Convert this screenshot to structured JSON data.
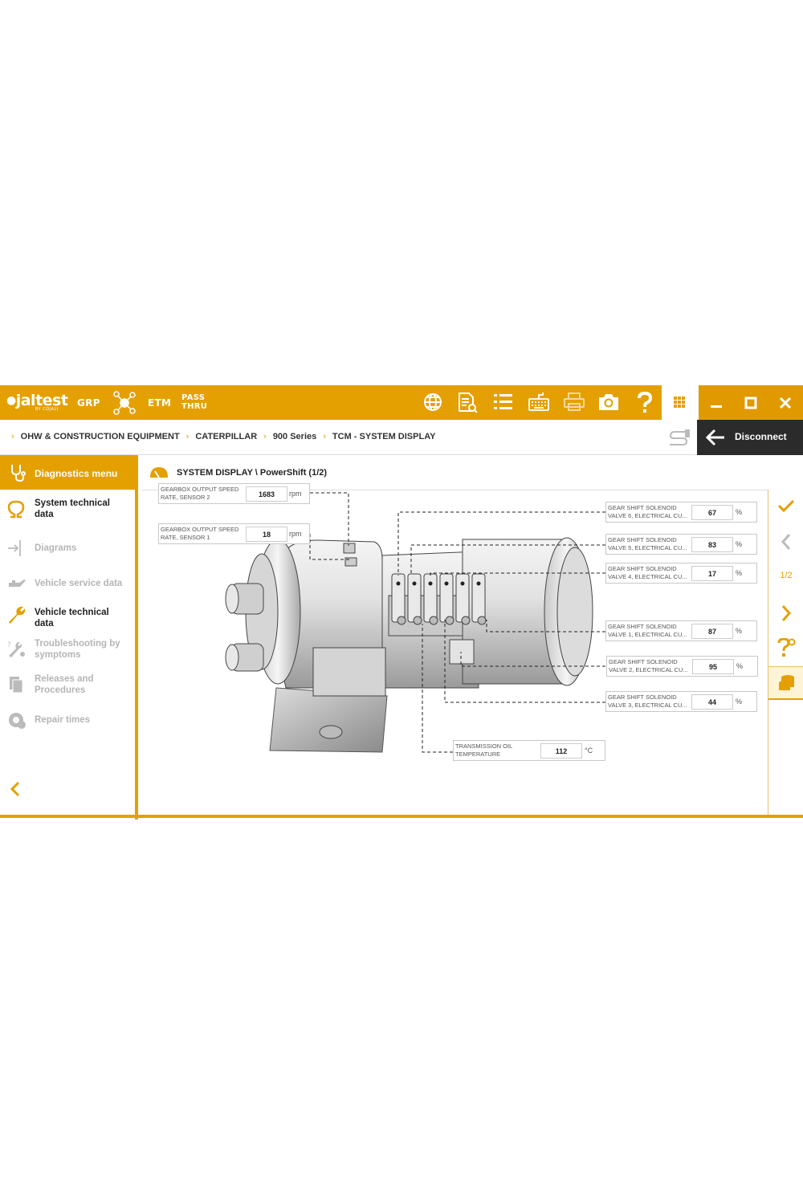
{
  "app": {
    "logo": "jaltest",
    "logo_sub": "BY COJALI",
    "nav": {
      "grp": "GRP",
      "etm": "ETM",
      "pass_thru_line1": "PASS",
      "pass_thru_line2": "THRU"
    },
    "toolbar_icons": [
      "globe-icon",
      "document-search-icon",
      "list-icon",
      "keyboard-icon",
      "printer-icon",
      "camera-icon",
      "help-icon",
      "grid-menu-icon"
    ],
    "window_controls": [
      "minimize-icon",
      "maximize-icon",
      "close-icon"
    ]
  },
  "breadcrumb": [
    "OHW & CONSTRUCTION EQUIPMENT",
    "CATERPILLAR",
    "900 Series",
    "TCM - SYSTEM DISPLAY"
  ],
  "disconnect_label": "Disconnect",
  "sidebar": {
    "header": "Diagnostics menu",
    "items": [
      {
        "label_line1": "System technical",
        "label_line2": "data",
        "state": "active",
        "icon": "omega-icon"
      },
      {
        "label_line1": "Diagrams",
        "label_line2": "",
        "state": "dim",
        "icon": "diagram-icon"
      },
      {
        "label_line1": "Vehicle service data",
        "label_line2": "",
        "state": "dim",
        "icon": "oil-can-icon"
      },
      {
        "label_line1": "Vehicle technical",
        "label_line2": "data",
        "state": "active",
        "icon": "wrench-icon"
      },
      {
        "label_line1": "Troubleshooting by",
        "label_line2": "symptoms",
        "state": "dim",
        "icon": "tools-icon"
      },
      {
        "label_line1": "Releases and",
        "label_line2": "Procedures",
        "state": "dim",
        "icon": "documents-icon"
      },
      {
        "label_line1": "Repair times",
        "label_line2": "",
        "state": "dim",
        "icon": "gear-clock-icon"
      }
    ]
  },
  "main": {
    "title": "SYSTEM DISPLAY \\ PowerShift (1/2)",
    "page_indicator": "1/2"
  },
  "readings": {
    "sensor2": {
      "label_line1": "GEARBOX OUTPUT SPEED",
      "label_line2": "RATE, SENSOR 2",
      "value": "1683",
      "unit": "rpm"
    },
    "sensor1": {
      "label_line1": "GEARBOX OUTPUT SPEED",
      "label_line2": "RATE, SENSOR 1",
      "value": "18",
      "unit": "rpm"
    },
    "valve6": {
      "label_line1": "GEAR SHIFT SOLENOID",
      "label_line2": "VALVE 6, ELECTRICAL CU...",
      "value": "67",
      "unit": "%"
    },
    "valve5": {
      "label_line1": "GEAR SHIFT SOLENOID",
      "label_line2": "VALVE 5, ELECTRICAL CU...",
      "value": "83",
      "unit": "%"
    },
    "valve4": {
      "label_line1": "GEAR SHIFT SOLENOID",
      "label_line2": "VALVE 4, ELECTRICAL CU...",
      "value": "17",
      "unit": "%"
    },
    "valve1": {
      "label_line1": "GEAR SHIFT SOLENOID",
      "label_line2": "VALVE 1, ELECTRICAL CU...",
      "value": "87",
      "unit": "%"
    },
    "valve2": {
      "label_line1": "GEAR SHIFT SOLENOID",
      "label_line2": "VALVE 2, ELECTRICAL CU...",
      "value": "95",
      "unit": "%"
    },
    "valve3": {
      "label_line1": "GEAR SHIFT SOLENOID",
      "label_line2": "VALVE 3, ELECTRICAL CU...",
      "value": "44",
      "unit": "%"
    },
    "oil_temp": {
      "label_line1": "TRANSMISSION OIL",
      "label_line2": "TEMPERATURE",
      "value": "112",
      "unit": "°C"
    }
  },
  "colors": {
    "accent": "#e4a000",
    "dark": "#2b2b2b",
    "dim_text": "#b5b5b5"
  }
}
